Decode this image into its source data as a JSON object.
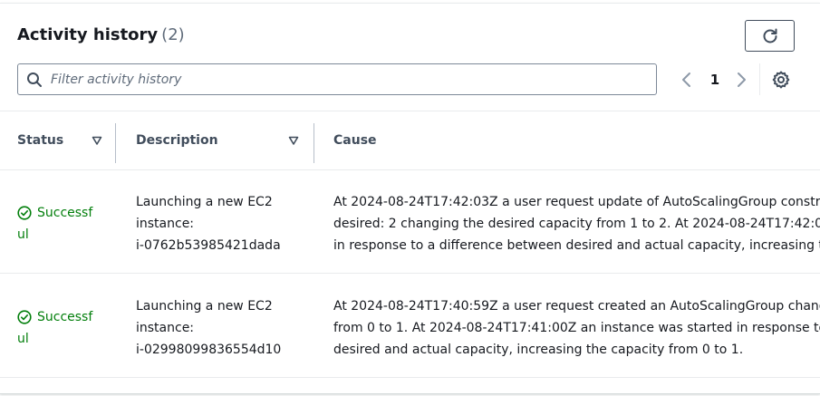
{
  "header": {
    "title": "Activity history",
    "count": "(2)"
  },
  "search": {
    "placeholder": "Filter activity history",
    "value": ""
  },
  "pagination": {
    "current_page": "1"
  },
  "columns": [
    {
      "label": "Status"
    },
    {
      "label": "Description"
    },
    {
      "label": "Cause"
    }
  ],
  "rows": [
    {
      "status": {
        "line1": "Successf",
        "line2": "ul",
        "full": "Successful"
      },
      "description": {
        "line1": "Launching a new EC2",
        "line2": "instance:",
        "line3": "i-0762b53985421dada"
      },
      "cause": {
        "line1": "At 2024-08-24T17:42:03Z a user request update of AutoScalingGroup constr",
        "line2": "desired: 2 changing the desired capacity from 1 to 2. At 2024-08-24T17:42:0",
        "line3": "in response to a difference between desired and actual capacity, increasing th"
      }
    },
    {
      "status": {
        "line1": "Successf",
        "line2": "ul",
        "full": "Successful"
      },
      "description": {
        "line1": "Launching a new EC2",
        "line2": "instance:",
        "line3": "i-02998099836554d10"
      },
      "cause": {
        "line1": "At 2024-08-24T17:40:59Z a user request created an AutoScalingGroup chang",
        "line2": "from 0 to 1. At 2024-08-24T17:41:00Z an instance was started in response to",
        "line3": "desired and actual capacity, increasing the capacity from 0 to 1."
      }
    }
  ],
  "icons": {
    "refresh": "refresh-icon",
    "search": "search-icon",
    "prev": "chevron-left-icon",
    "next": "chevron-right-icon",
    "settings": "gear-icon",
    "sort": "caret-down-icon",
    "status_ok": "check-circle-icon"
  },
  "colors": {
    "success": "#037f0c",
    "text": "#16191f",
    "border": "#7d8998",
    "muted": "#5f6b7a"
  }
}
